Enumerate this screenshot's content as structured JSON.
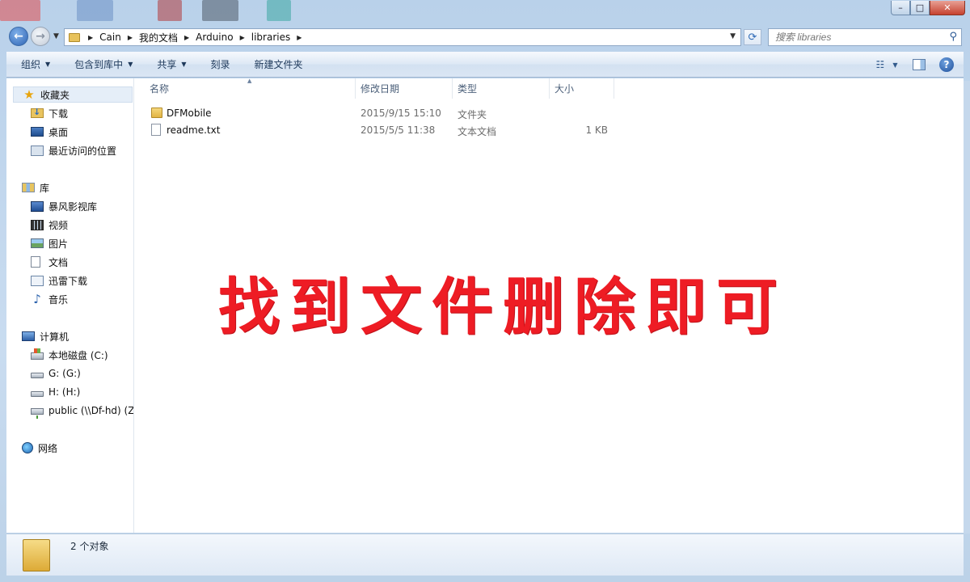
{
  "window": {
    "controls": {
      "minimize": "–",
      "maximize": "□",
      "close": "✕"
    }
  },
  "nav": {
    "back_icon": "arrow-left-icon",
    "forward_icon": "arrow-right-icon",
    "breadcrumb": [
      "Cain",
      "我的文档",
      "Arduino",
      "libraries"
    ],
    "search_placeholder": "搜索 libraries"
  },
  "toolbar": {
    "organize": "组织",
    "include_in_library": "包含到库中",
    "share": "共享",
    "burn": "刻录",
    "new_folder": "新建文件夹"
  },
  "sidebar": {
    "favorites": {
      "label": "收藏夹",
      "items": [
        "下载",
        "桌面",
        "最近访问的位置"
      ]
    },
    "libraries": {
      "label": "库",
      "items": [
        "暴风影视库",
        "视频",
        "图片",
        "文档",
        "迅雷下载",
        "音乐"
      ]
    },
    "computer": {
      "label": "计算机",
      "items": [
        "本地磁盘 (C:)",
        "G: (G:)",
        "H: (H:)",
        "public (\\\\Df-hd) (Z"
      ]
    },
    "network": {
      "label": "网络"
    }
  },
  "columns": {
    "name": "名称",
    "modified": "修改日期",
    "type": "类型",
    "size": "大小"
  },
  "files": [
    {
      "name": "DFMobile",
      "modified": "2015/9/15 15:10",
      "type": "文件夹",
      "size": "",
      "icon": "folder-icon"
    },
    {
      "name": "readme.txt",
      "modified": "2015/5/5 11:38",
      "type": "文本文档",
      "size": "1 KB",
      "icon": "text-file-icon"
    }
  ],
  "overlay_text": "找到文件删除即可",
  "details": {
    "count": "2 个对象"
  },
  "colors": {
    "overlay": "#ee1c24",
    "accent": "#1e395b"
  }
}
